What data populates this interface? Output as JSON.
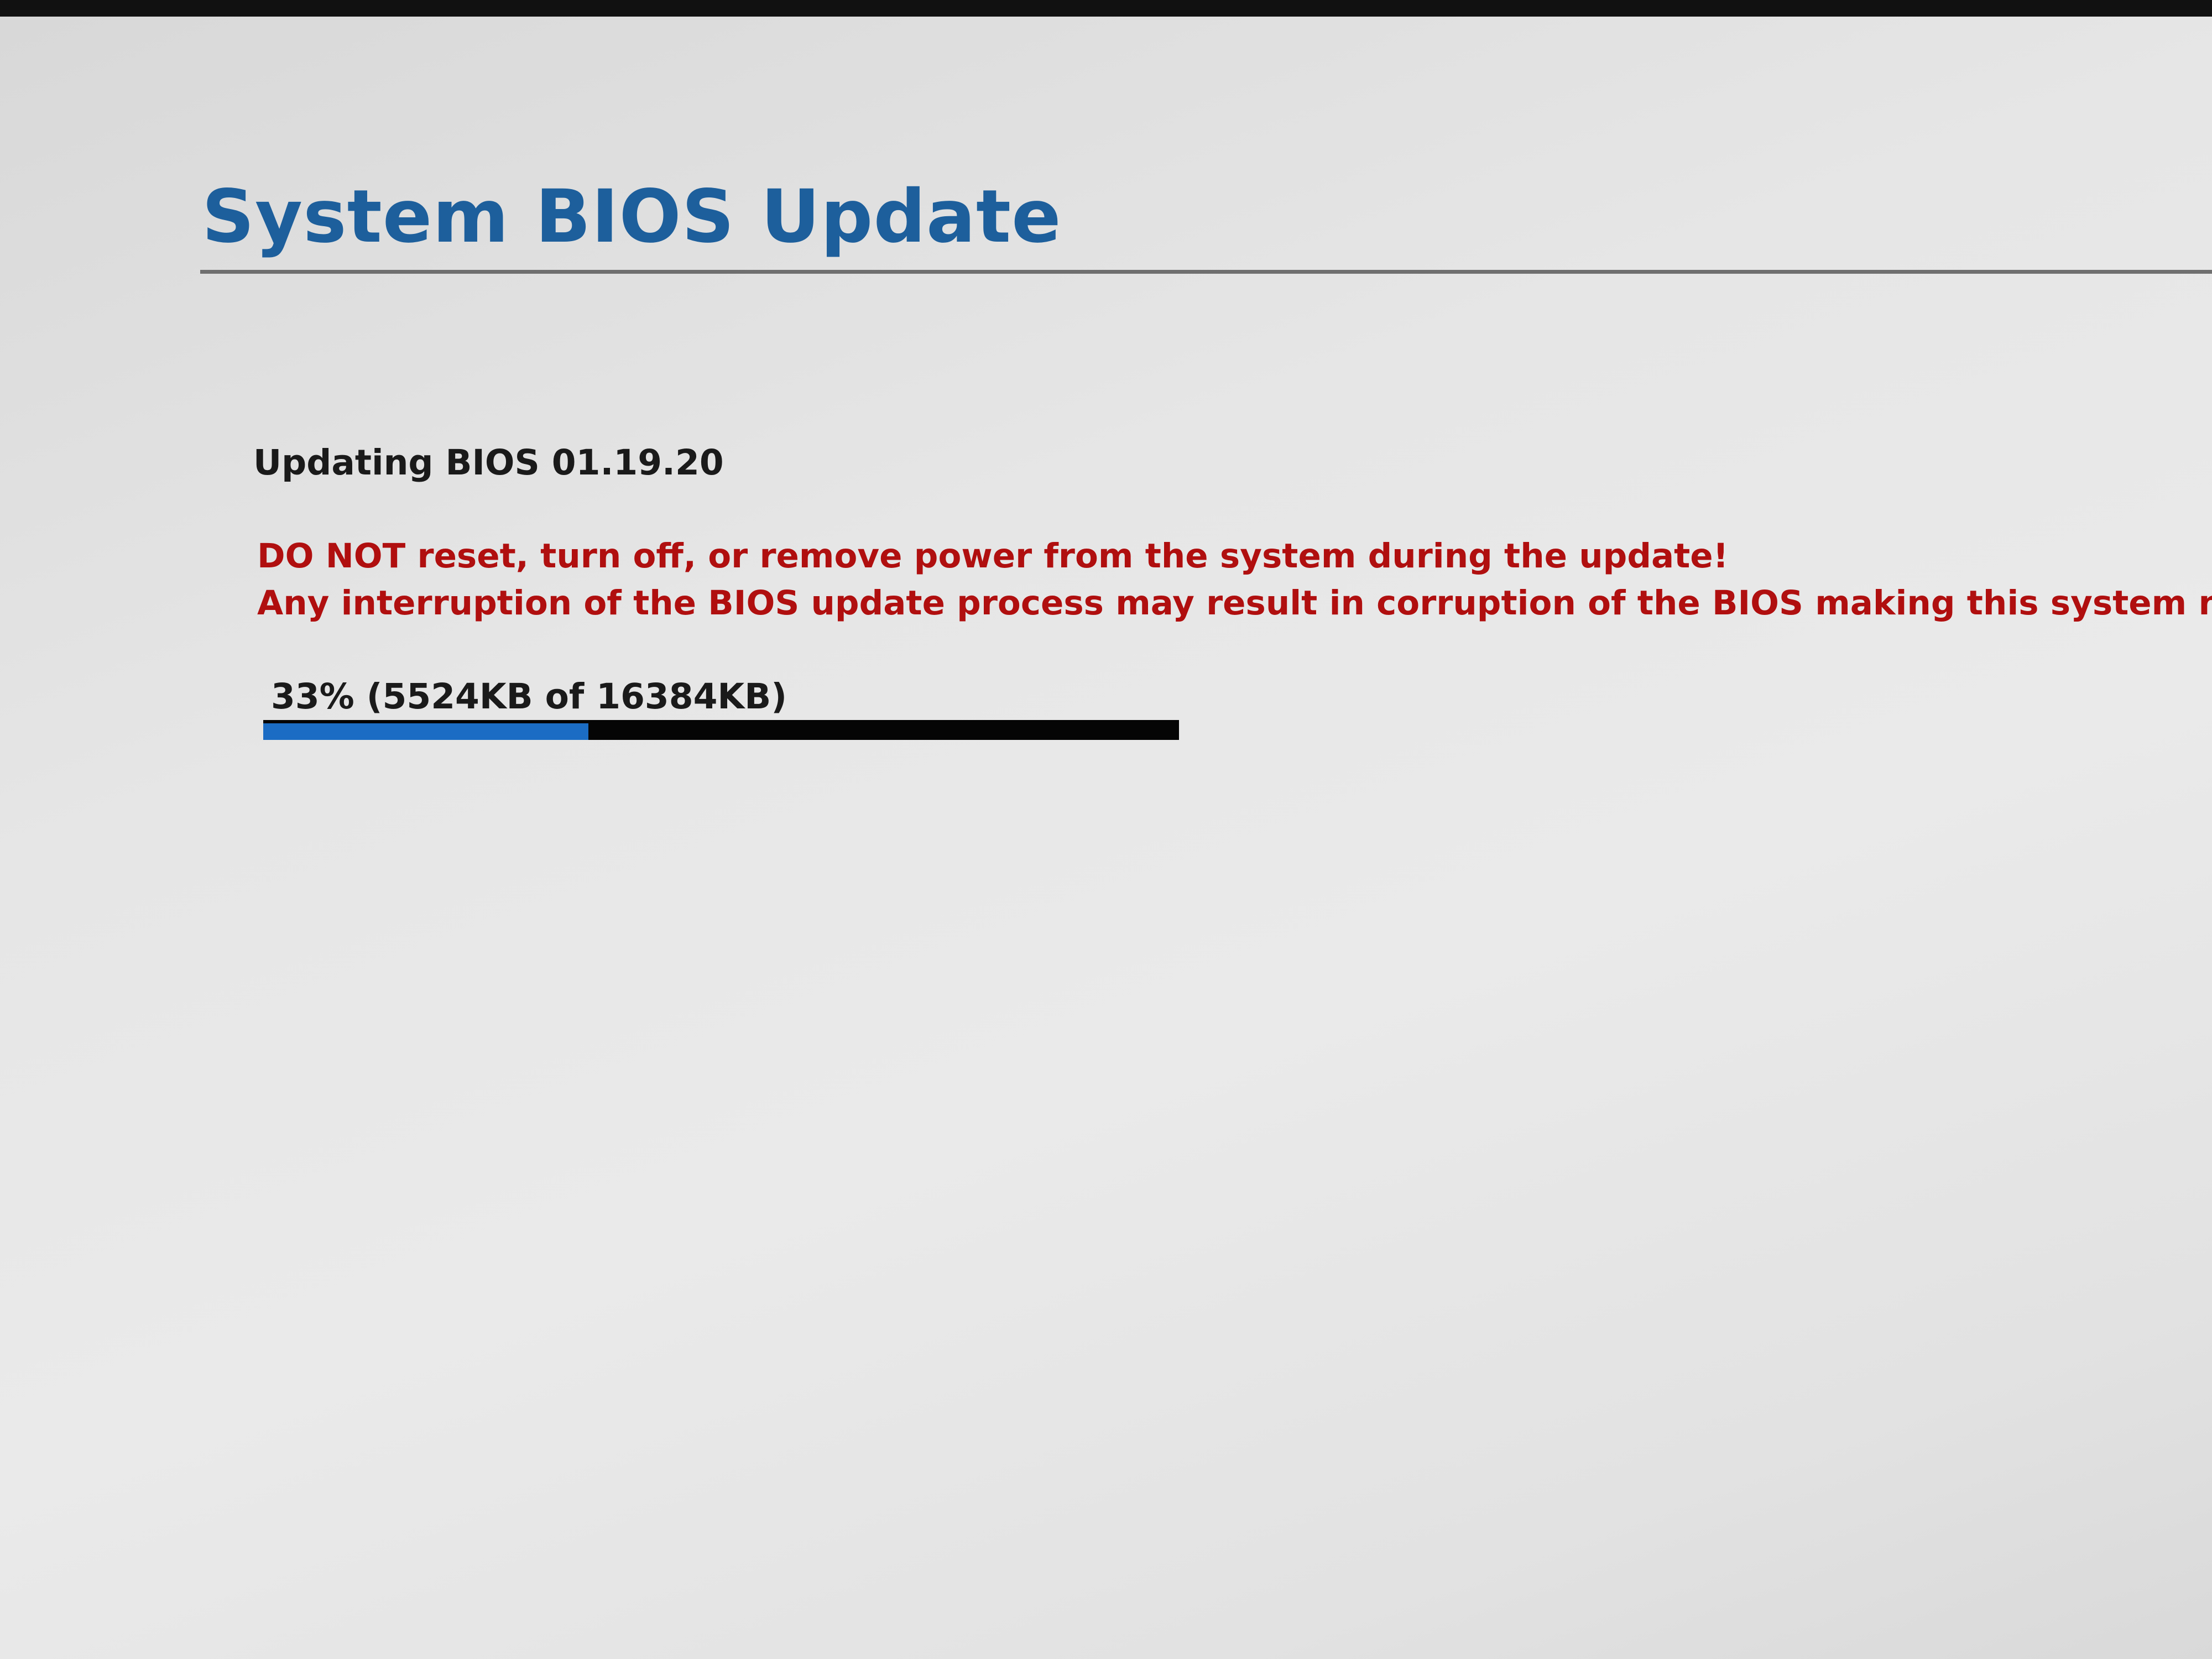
{
  "title": "System BIOS Update",
  "status": "Updating BIOS 01.19.20",
  "warnings": {
    "line1": "DO NOT reset, turn off, or remove power from the system during the update!",
    "line2": "Any interruption of the BIOS update process may result in corruption of the BIOS making this system non-func"
  },
  "progress": {
    "label": "33% (5524KB of 16384KB)",
    "fraction": 0.355
  },
  "colors": {
    "title": "#1d5f9c",
    "warning": "#b00f0f",
    "progress_fill": "#1b6cc4",
    "progress_track": "#050505"
  }
}
